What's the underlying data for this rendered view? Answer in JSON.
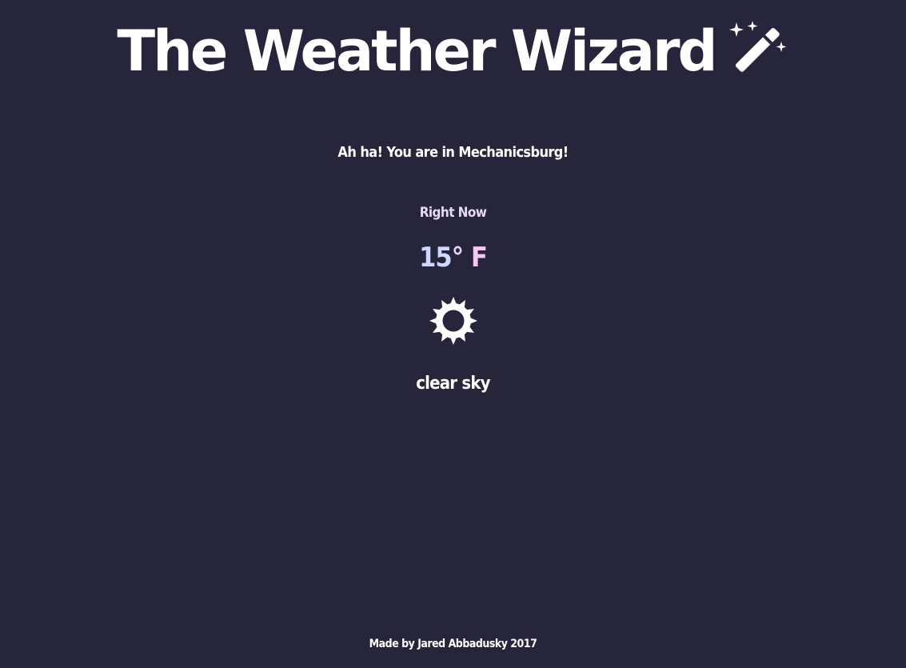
{
  "header": {
    "title": "The Weather Wizard",
    "icon": "magic-wand-icon"
  },
  "location": {
    "message": "Ah ha! You are in Mechanicsburg!"
  },
  "current": {
    "label": "Right Now",
    "temperature": "15",
    "degree_symbol": "°",
    "unit": "F",
    "icon": "sun-icon",
    "description": "clear sky"
  },
  "footer": {
    "credit": "Made by Jared Abbadusky 2017"
  },
  "colors": {
    "background": "#27253b",
    "text": "#ffffff",
    "accent_label": "#e8d8f8",
    "temperature_value": "#cfd6ff",
    "temperature_unit": "#f5c8f3"
  }
}
